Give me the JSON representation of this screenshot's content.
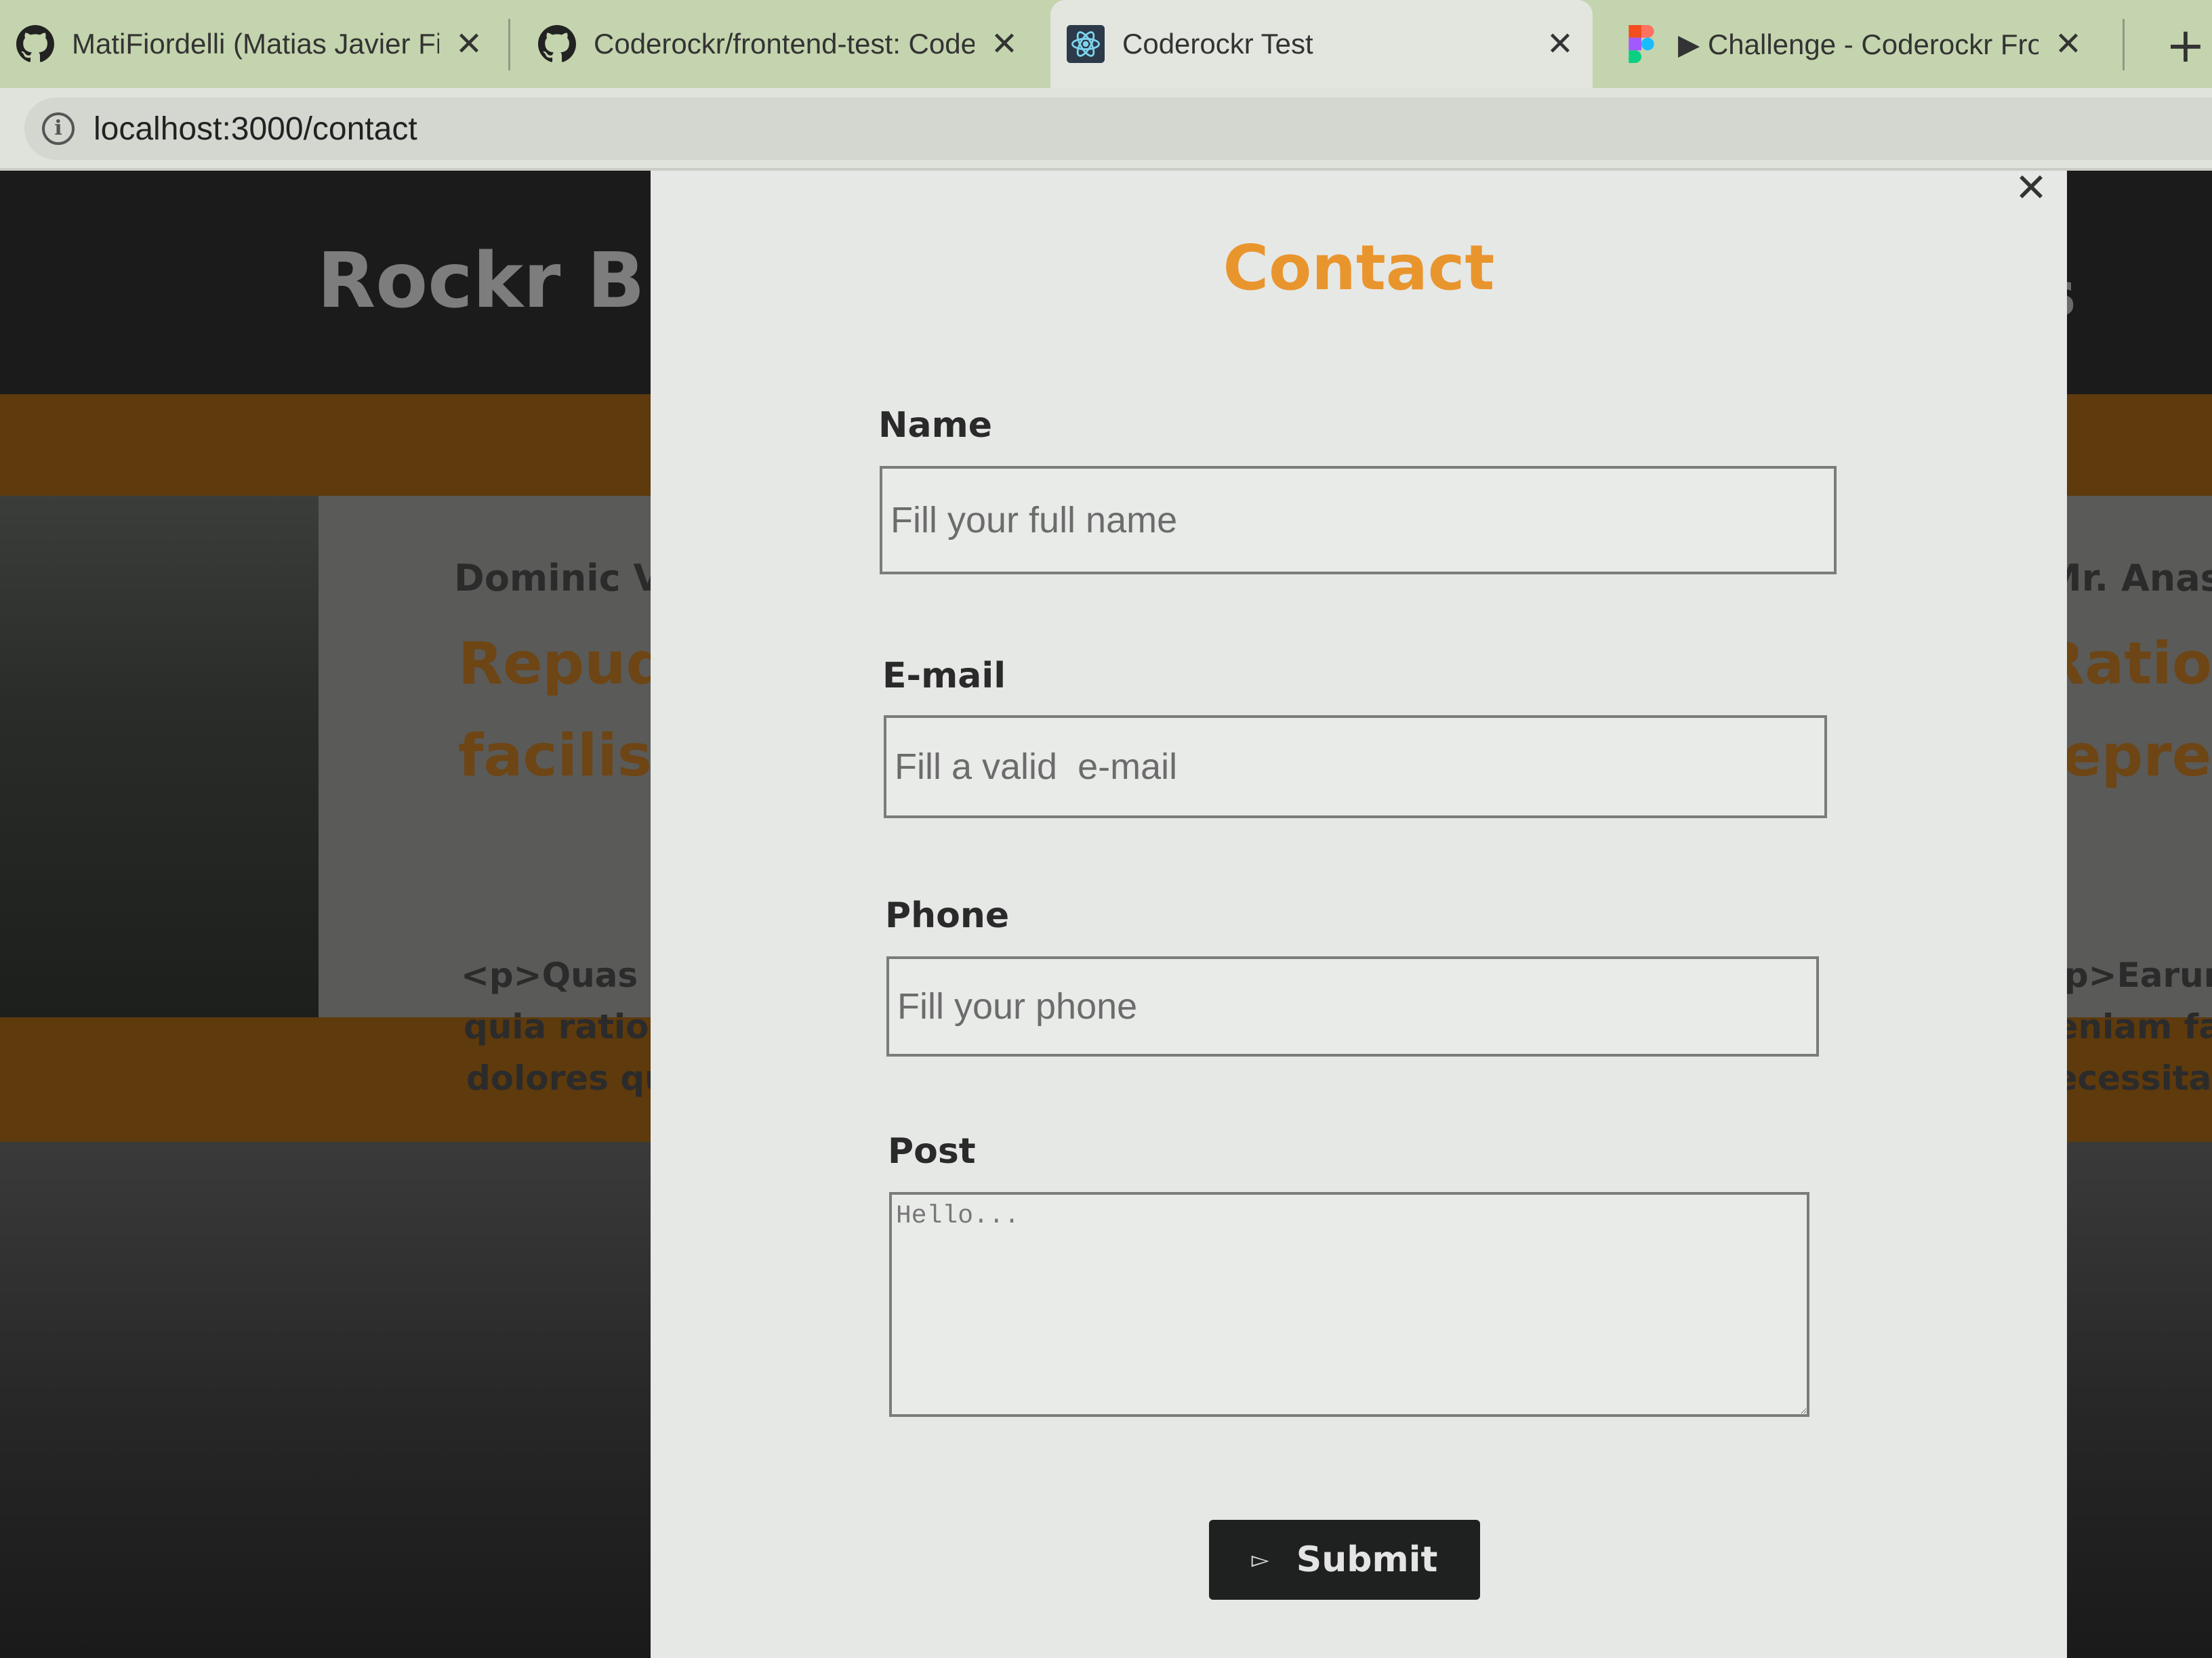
{
  "browser": {
    "tabs": [
      {
        "title": "MatiFiordelli (Matias Javier Fio",
        "icon": "github-icon",
        "active": false
      },
      {
        "title": "Coderockr/frontend-test: Code",
        "icon": "github-icon",
        "active": false
      },
      {
        "title": "Coderockr Test",
        "icon": "react-icon",
        "active": true
      },
      {
        "title": "▶ Challenge - Coderockr Front",
        "icon": "figma-icon",
        "active": false
      }
    ],
    "close_glyph": "✕",
    "new_tab_glyph": "+",
    "url": "localhost:3000/contact"
  },
  "background_page": {
    "logo": "Rockr Bl",
    "logo_right": "s",
    "left_card": {
      "author": "Dominic Ve",
      "title_lines": [
        "Repudi",
        "facilis"
      ],
      "body_lines": [
        "<p>Quas lau",
        "quia ration",
        "dolores qui"
      ]
    },
    "right_card": {
      "author": "Mr. Anast",
      "title_lines": [
        "Ration",
        "reprel"
      ],
      "body_lines": [
        "<p>Earum",
        "veniam fac",
        "necessitat"
      ]
    }
  },
  "modal": {
    "close_glyph": "✕",
    "title": "Contact",
    "fields": {
      "name": {
        "label": "Name",
        "placeholder": "Fill your full name"
      },
      "email": {
        "label": "E-mail",
        "placeholder": "Fill a valid  e-mail"
      },
      "phone": {
        "label": "Phone",
        "placeholder": "Fill your phone"
      },
      "post": {
        "label": "Post",
        "placeholder": "Hello..."
      }
    },
    "submit": {
      "label": "Submit",
      "icon": "send-icon",
      "icon_glyph": "▻"
    }
  },
  "colors": {
    "accent": "#e9952e",
    "tabbar": "#c4d4ae",
    "button": "#1f2121"
  }
}
